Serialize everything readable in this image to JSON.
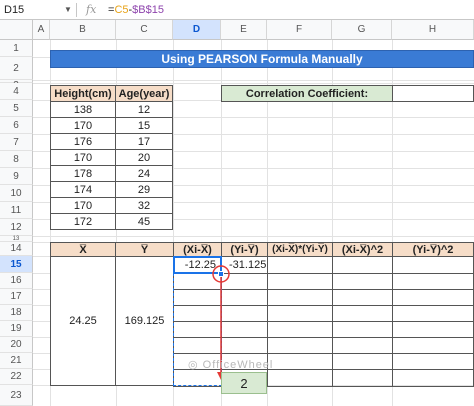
{
  "name_box": "D15",
  "formula": {
    "eq": "=",
    "ref1": "C5",
    "op": "-",
    "ref2": "$B$15"
  },
  "columns": [
    "A",
    "B",
    "C",
    "D",
    "E",
    "F",
    "G",
    "H"
  ],
  "rows": [
    "1",
    "2",
    "3",
    "4",
    "5",
    "6",
    "7",
    "8",
    "9",
    "10",
    "11",
    "12",
    "13",
    "14",
    "15",
    "16",
    "17",
    "18",
    "19",
    "20",
    "21",
    "22",
    "23"
  ],
  "title": "Using PEARSON Formula Manually",
  "data_table": {
    "headers": [
      "Height(cm)",
      "Age(year)"
    ],
    "rows": [
      [
        "138",
        "12"
      ],
      [
        "170",
        "15"
      ],
      [
        "176",
        "17"
      ],
      [
        "170",
        "20"
      ],
      [
        "178",
        "24"
      ],
      [
        "174",
        "29"
      ],
      [
        "170",
        "32"
      ],
      [
        "172",
        "45"
      ]
    ]
  },
  "correlation_label": "Correlation Coefficient:",
  "calc_table": {
    "headers": [
      "X̅",
      "Y̅",
      "(Xi-X̅)",
      "(Yi-Y̅)",
      "(Xi-X̅)*(Yi-Y̅)",
      "(Xi-X̅)^2",
      "(Yi-Y̅)^2"
    ],
    "x_mean": "24.25",
    "y_mean": "169.125",
    "d15": "-12.25",
    "e15": "-31.125"
  },
  "watermark": "OfficeWheel",
  "fill_tooltip": "2",
  "colors": {
    "title_bg": "#3a7bd5",
    "header_bg": "#f6ddc8",
    "corr_bg": "#d9ead3",
    "selection": "#1a73e8",
    "fill_arrow": "#e53935"
  }
}
